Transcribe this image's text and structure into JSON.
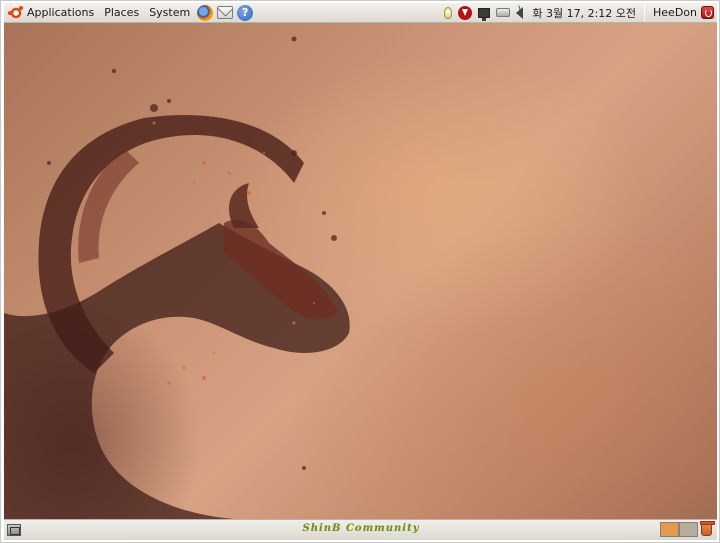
{
  "top_panel": {
    "menus": [
      "Applications",
      "Places",
      "System"
    ],
    "launchers": [
      "firefox-icon",
      "mail-icon",
      "help-icon"
    ],
    "help_glyph": "?",
    "tray_icons": [
      "lightbulb-icon",
      "update-notifier-icon",
      "network-icon",
      "printer-icon",
      "volume-icon"
    ],
    "clock": "화 3월 17,  2:12 오전",
    "user": "HeeDon",
    "session_icon": "shutdown-icon"
  },
  "desktop": {
    "wallpaper": "ubuntu-ink-wallpaper",
    "colors": {
      "base": "#c99274",
      "light": "#d7a383",
      "ink_dark": "#3f1d18",
      "ink_mid": "#6e2e22",
      "ember": "#d46a3a"
    }
  },
  "bottom_panel": {
    "show_desktop_icon": "show-desktop-icon",
    "brand": "ShinB Community",
    "workspace_colors": {
      "active": "#e39a4a",
      "inactive": "#b6ada0"
    },
    "trash_icon": "trash-icon"
  }
}
